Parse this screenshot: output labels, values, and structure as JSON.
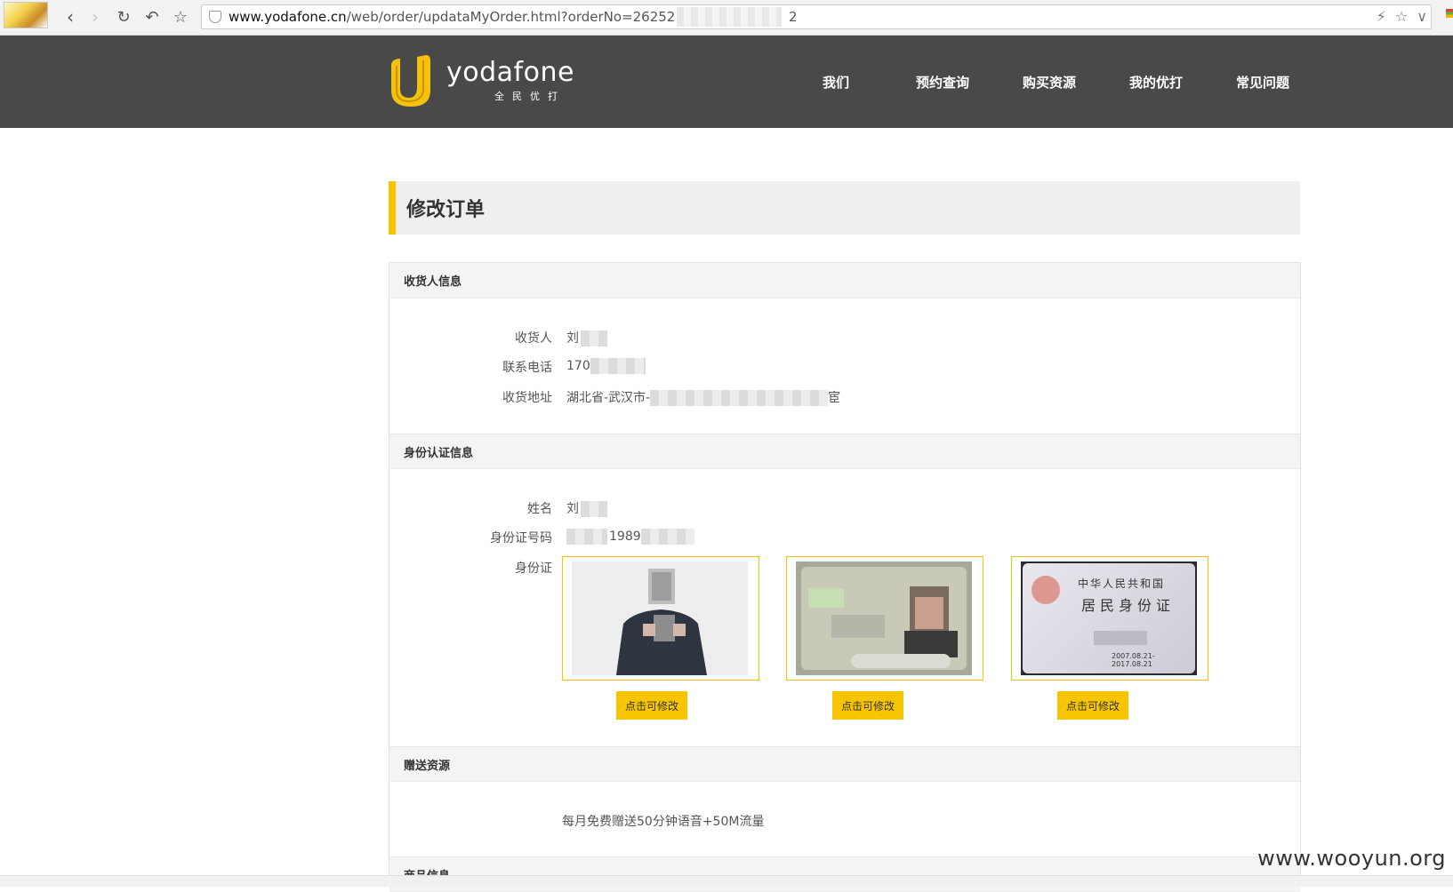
{
  "browser": {
    "url_host": "www.yodafone.cn",
    "url_path": "/web/order/updataMyOrder.html?orderNo=26252",
    "url_tail": "2"
  },
  "header": {
    "brand_name": "yodafone",
    "brand_tagline": "全民优打",
    "nav": [
      {
        "label": "我们"
      },
      {
        "label": "预约查询"
      },
      {
        "label": "购买资源"
      },
      {
        "label": "我的优打"
      },
      {
        "label": "常见问题"
      }
    ]
  },
  "page": {
    "title": "修改订单"
  },
  "recipient": {
    "section_title": "收货人信息",
    "name_label": "收货人",
    "name_value": "刘",
    "phone_label": "联系电话",
    "phone_value": "170",
    "address_label": "收货地址",
    "address_value": "湖北省-武汉市-",
    "address_tail": "宦"
  },
  "identity": {
    "section_title": "身份认证信息",
    "name_label": "姓名",
    "name_value": "刘",
    "idno_label": "身份证号码",
    "idno_value": "1989",
    "idcard_label": "身份证",
    "edit_label": "点击可修改",
    "card_back_line1": "中华人民共和国",
    "card_back_line2": "居民身份证",
    "card_back_validity": "2007.08.21-2017.08.21"
  },
  "gift": {
    "section_title": "赠送资源",
    "text": "每月免费赠送50分钟语音+50M流量"
  },
  "product": {
    "section_title": "商品信息"
  },
  "watermark": "www.wooyun.org",
  "colors": {
    "accent": "#f7c500",
    "header_bg": "#4a4949"
  }
}
